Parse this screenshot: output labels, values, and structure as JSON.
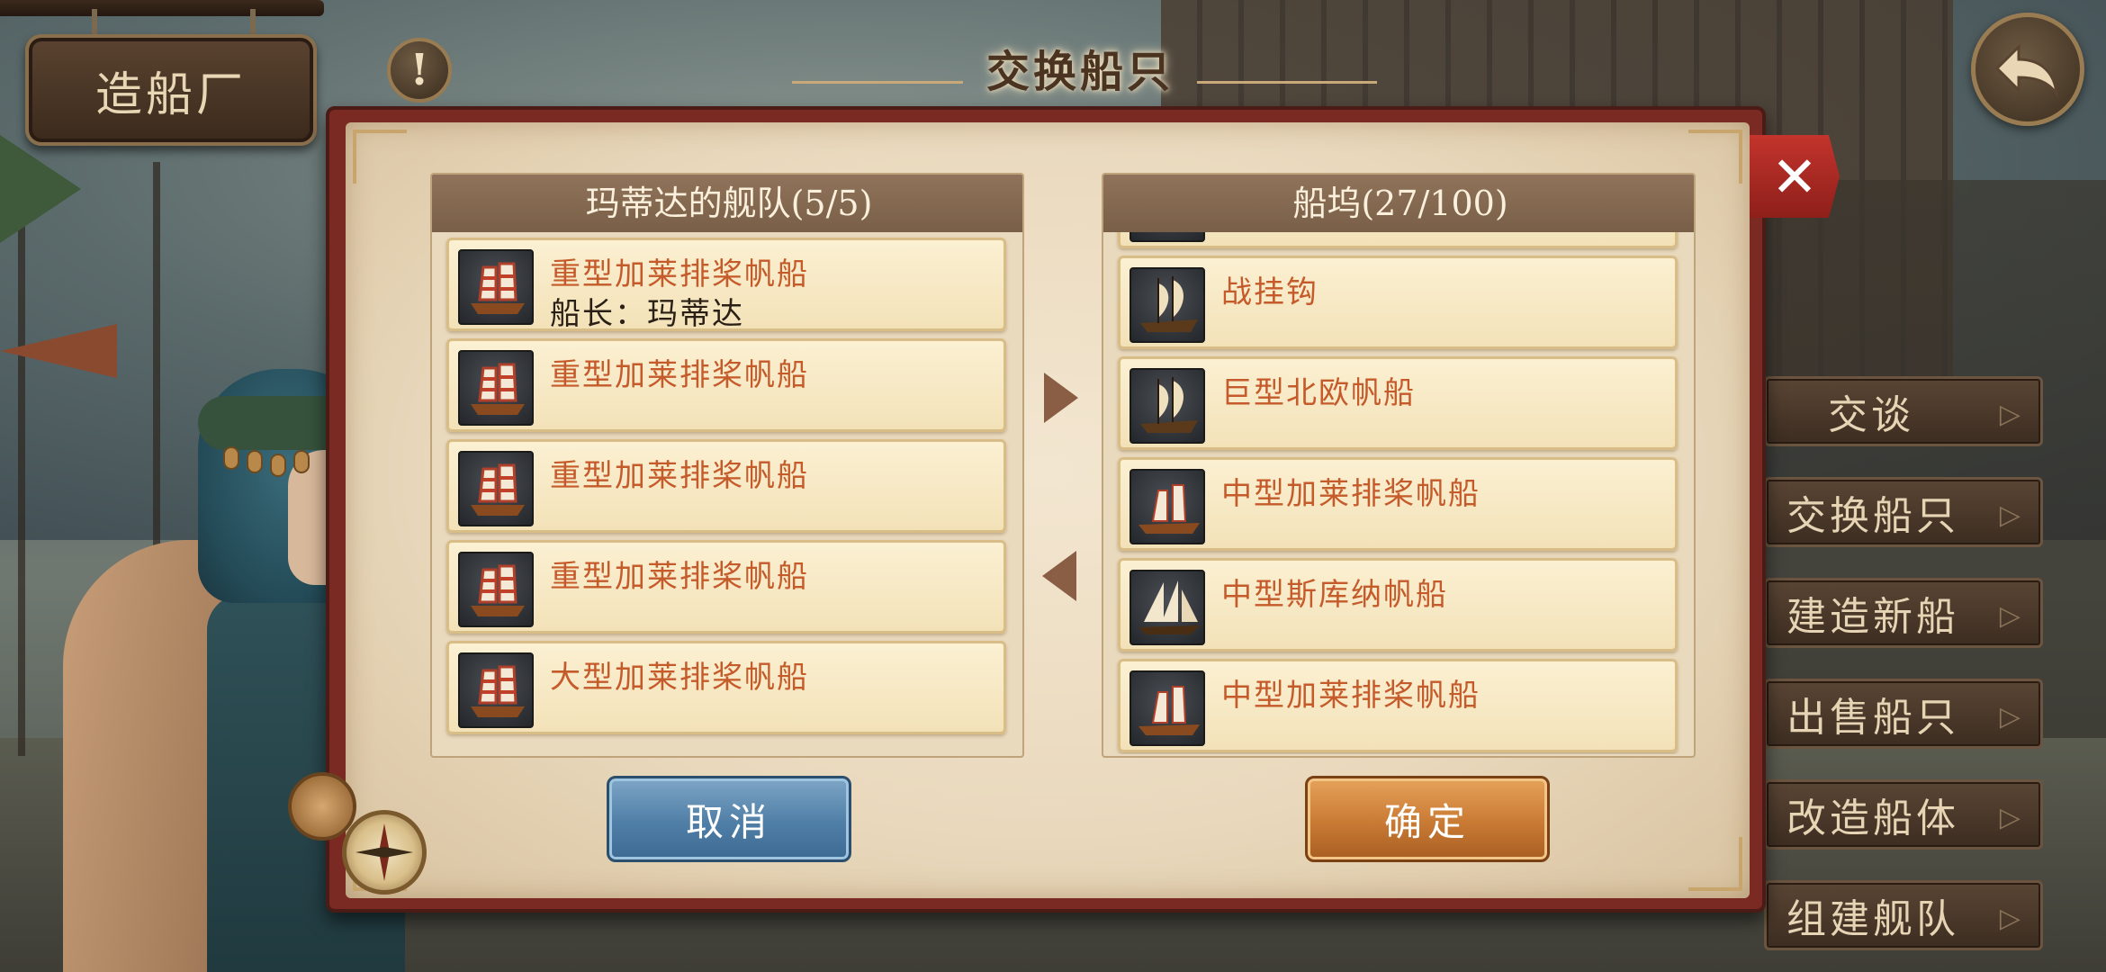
{
  "location_sign": "造船厂",
  "dialog": {
    "title": "交换船只",
    "fleet_panel": {
      "header": "玛蒂达的舰队(5/5)",
      "ships": [
        {
          "name": "重型加莱排桨帆船",
          "captain": "船长：玛蒂达",
          "icon": "galley-ship-icon"
        },
        {
          "name": "重型加莱排桨帆船",
          "captain": "",
          "icon": "galley-ship-icon"
        },
        {
          "name": "重型加莱排桨帆船",
          "captain": "",
          "icon": "galley-ship-icon"
        },
        {
          "name": "重型加莱排桨帆船",
          "captain": "",
          "icon": "galley-ship-icon"
        },
        {
          "name": "大型加莱排桨帆船",
          "captain": "",
          "icon": "galley-ship-icon"
        }
      ]
    },
    "dock_panel": {
      "header": "船坞(27/100)",
      "ships": [
        {
          "name": "",
          "icon": "cog-ship-icon"
        },
        {
          "name": "战挂钩",
          "icon": "cog-ship-icon"
        },
        {
          "name": "巨型北欧帆船",
          "icon": "cog-ship-icon"
        },
        {
          "name": "中型加莱排桨帆船",
          "icon": "small-galley-icon"
        },
        {
          "name": "中型斯库纳帆船",
          "icon": "schooner-icon"
        },
        {
          "name": "中型加莱排桨帆船",
          "icon": "small-galley-icon"
        }
      ]
    },
    "cancel_label": "取消",
    "confirm_label": "确定",
    "close_label": "✕"
  },
  "side_menu": [
    "交谈",
    "交换船只",
    "建造新船",
    "出售船只",
    "改造船体",
    "组建舰队"
  ],
  "colors": {
    "ship_name": "#c55a2a",
    "dialog_frame": "#7a2a22",
    "confirm": "#c97a34",
    "cancel": "#4f7ea6"
  }
}
